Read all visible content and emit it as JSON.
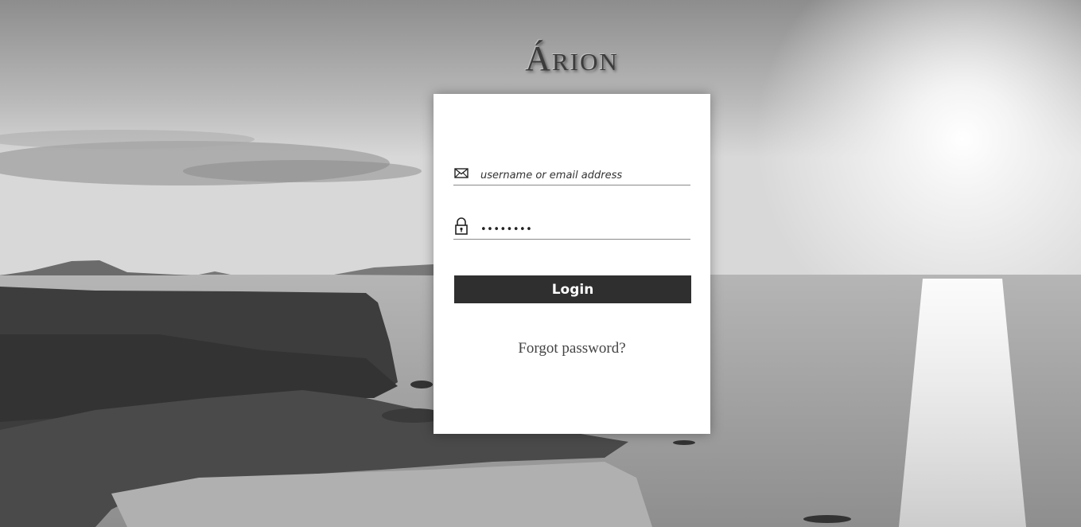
{
  "brand": {
    "title": "Árion"
  },
  "login_form": {
    "username": {
      "placeholder": "username or email address",
      "value": "",
      "icon": "envelope-icon"
    },
    "password": {
      "placeholder": "",
      "value": "password",
      "icon": "lock-icon"
    },
    "login_button_label": "Login",
    "forgot_password_label": "Forgot password?"
  },
  "colors": {
    "button_bg": "#2f2f2f",
    "card_bg": "#ffffff",
    "brand_text": "#3c3c3c"
  }
}
